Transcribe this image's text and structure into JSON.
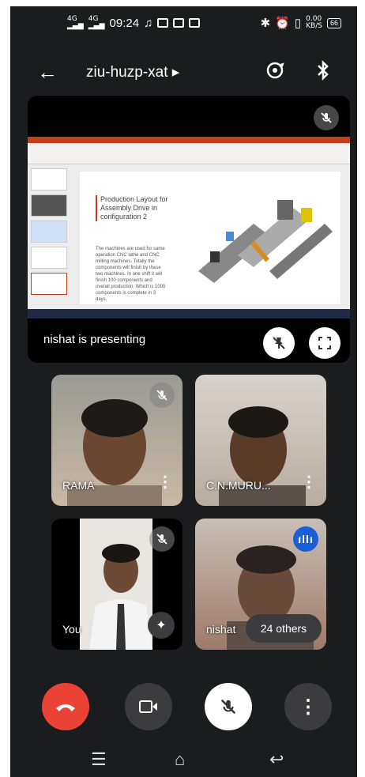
{
  "status_bar": {
    "net_left": "4G",
    "net_right": "4G",
    "time": "09:24",
    "speed_top": "0.00",
    "speed_bottom": "KB/S",
    "battery": "66"
  },
  "header": {
    "meeting_code": "ziu-huzp-xat"
  },
  "presentation": {
    "label": "nishat is presenting",
    "slide_title": "Production Layout for Assembly Drive in configuration 2",
    "slide_body": "The machines are used for same operation CNC lathe and CNC milling machines. Totally the components will finish by these two machines. In one shift it will finish 100 components and overall production. Which is 1000 components is complete in 3 days."
  },
  "participants": [
    {
      "name": "RAMA"
    },
    {
      "name": "C.N.MURU..."
    },
    {
      "name": "You"
    },
    {
      "name": "nishat"
    }
  ],
  "others_badge": "24 others",
  "colors": {
    "background": "#1b1c1e",
    "end_call": "#ea4335",
    "control": "#3c3c3e",
    "active_speaker": "#1a5fd6"
  }
}
